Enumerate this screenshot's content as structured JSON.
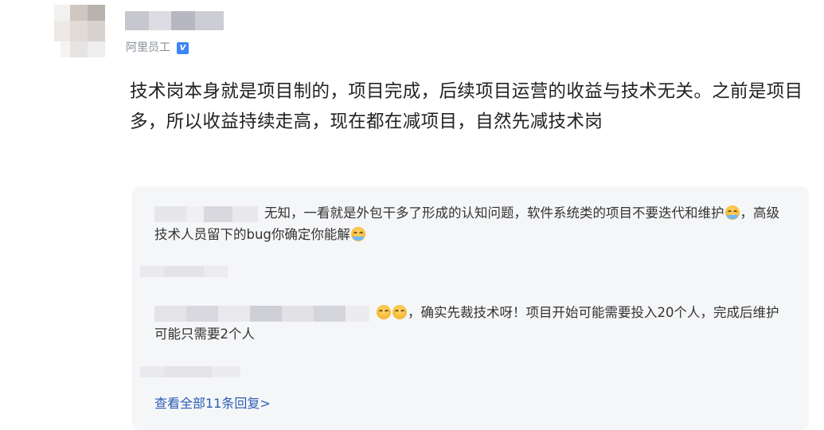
{
  "post": {
    "author_org": "阿里员工",
    "verified_icon": "verified-badge-icon",
    "body": "技术岗本身就是项目制的，项目完成，后续项目运营的收益与技术无关。之前是项目多，所以收益持续走高，现在都在减项目，自然先减技术岗"
  },
  "replies": [
    {
      "text_a": "无知，一看就是外包干多了形成的认知问题，软件系统类的项目不要迭代和维护",
      "emoji_a": "crying-laughing-emoji",
      "text_b": "，高级技术人员留下的bug你确定你能解",
      "emoji_b": "crying-laughing-emoji"
    },
    {
      "emoji_a": "sad-face-emoji",
      "text_a": "，确实先裁技术呀！项目开始可能需要投入20个人，完成后维护可能只需要2个人"
    }
  ],
  "view_all_label": "查看全部11条回复>",
  "colors": {
    "reply_bg": "#f5f6f8",
    "link": "#2d5db3",
    "verified": "#3c86f7"
  }
}
